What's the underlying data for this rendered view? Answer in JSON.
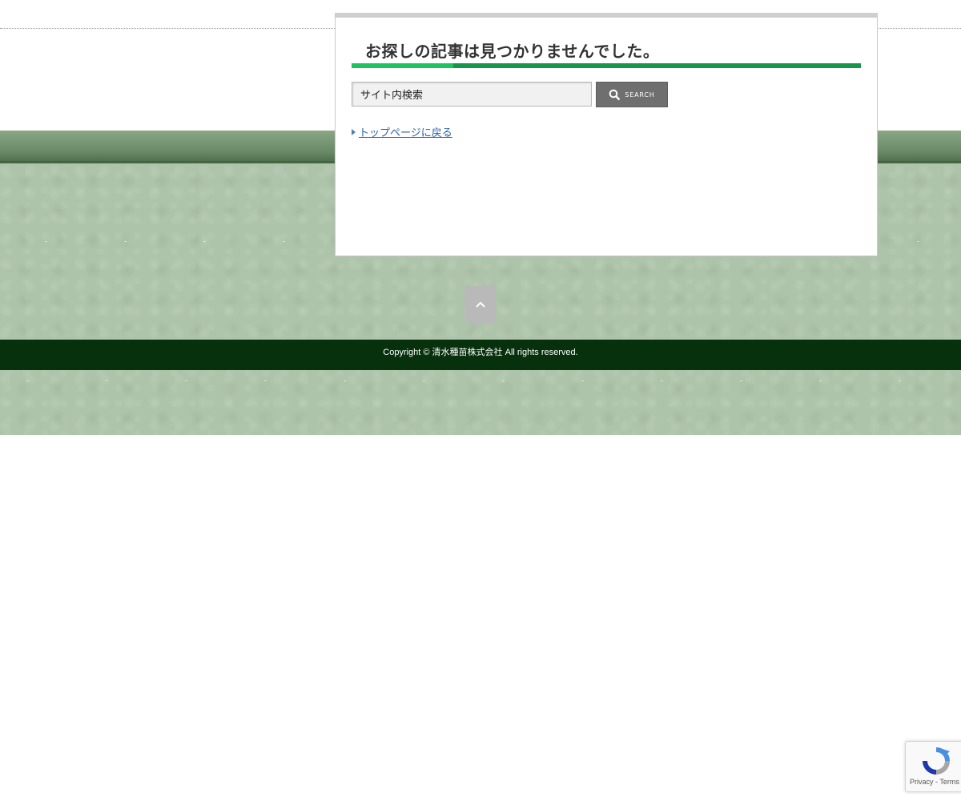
{
  "main": {
    "title": "お探しの記事は見つかりませんでした。",
    "search": {
      "value": "サイト内検索",
      "button_label": "SEARCH",
      "button_icon": "search-icon"
    },
    "back_link": "トップページに戻る"
  },
  "page_top": {
    "icon": "chevron-up-icon"
  },
  "footer": {
    "copyright": "Copyright ©  清水種苗株式会社 All rights reserved."
  },
  "recaptcha": {
    "terms": "Privacy - Terms"
  },
  "colors": {
    "accent_green": "#1ec25f",
    "dark_green": "#16964a",
    "footer_bg": "#07310d",
    "texture_bg": "#aec4aa",
    "link": "#2b5fa8"
  }
}
